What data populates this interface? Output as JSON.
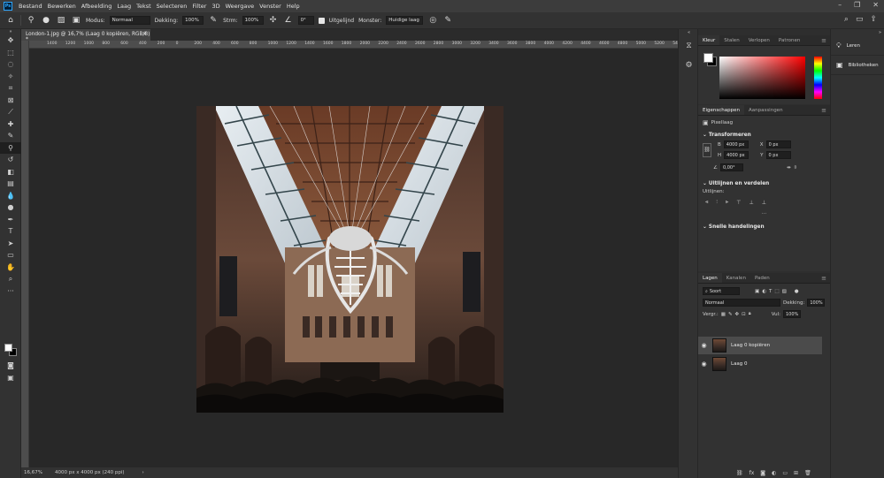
{
  "app": {
    "logo": "Ps"
  },
  "menu": [
    "Bestand",
    "Bewerken",
    "Afbeelding",
    "Laag",
    "Tekst",
    "Selecteren",
    "Filter",
    "3D",
    "Weergave",
    "Venster",
    "Help"
  ],
  "options": {
    "mode_label": "Modus:",
    "mode_value": "Normaal",
    "opacity_label": "Dekking:",
    "opacity_value": "100%",
    "flow_label": "Strm:",
    "flow_value": "100%",
    "angle_value": "0°",
    "aligned_label": "Uitgelijnd",
    "sample_label": "Monster:",
    "sample_value": "Huidige laag"
  },
  "document": {
    "tab_title": "London-1.jpg @ 16,7% (Laag 0 kopiëren, RGB/8) *",
    "zoom": "16,67%",
    "size": "4000 px x 4000 px (240 ppi)",
    "ruler_ticks": [
      "1400",
      "1200",
      "1000",
      "800",
      "600",
      "400",
      "200",
      "0",
      "200",
      "400",
      "600",
      "800",
      "1000",
      "1200",
      "1400",
      "1600",
      "1800",
      "2000",
      "2200",
      "2400",
      "2600",
      "2800",
      "3000",
      "3200",
      "3400",
      "3600",
      "3800",
      "4000",
      "4200",
      "4400",
      "4600",
      "4800",
      "5000",
      "5200",
      "5400"
    ]
  },
  "color_panel": {
    "tabs": [
      "Kleur",
      "Stalen",
      "Verlopen",
      "Patronen"
    ],
    "active": "Kleur"
  },
  "properties_panel": {
    "tabs": [
      "Eigenschappen",
      "Aanpassingen"
    ],
    "layer_type": "Pixellaag",
    "transform_title": "Transformeren",
    "w_label": "B",
    "w_value": "4000 px",
    "h_label": "H",
    "h_value": "4000 px",
    "x_label": "X",
    "x_value": "0 px",
    "y_label": "Y",
    "y_value": "0 px",
    "angle_value": "0,00°",
    "align_title": "Uitlijnen en verdelen",
    "align_label": "Uitlijnen:",
    "quick_title": "Snelle handelingen"
  },
  "layers_panel": {
    "tabs": [
      "Lagen",
      "Kanalen",
      "Paden"
    ],
    "filter_label": "Soort",
    "blend_mode": "Normaal",
    "opacity_label": "Dekking:",
    "opacity_value": "100%",
    "lock_label": "Vergr.:",
    "fill_label": "Vul:",
    "fill_value": "100%",
    "layers": [
      {
        "name": "Laag 0 kopiëren",
        "selected": true
      },
      {
        "name": "Laag 0",
        "selected": false
      }
    ]
  },
  "learn_panel": {
    "items": [
      "Leren",
      "Bibliotheken"
    ]
  },
  "colors": {
    "foreground": "#ffffff",
    "background": "#000000",
    "hue_selected": "#ff0000"
  }
}
